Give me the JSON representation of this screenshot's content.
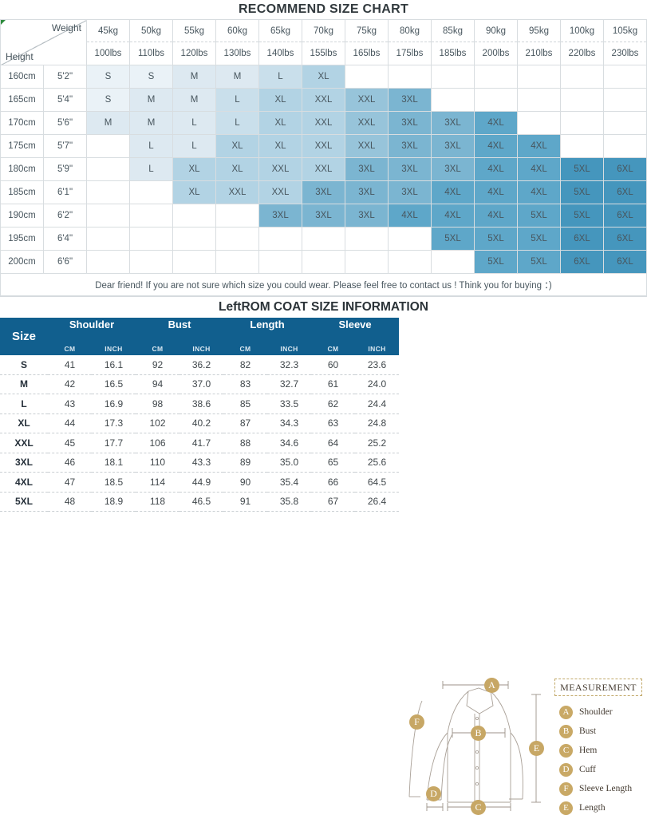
{
  "chart": {
    "title": "RECOMMEND SIZE CHART",
    "corner": {
      "weight_label": "Weight",
      "height_label": "Height"
    },
    "weights_kg": [
      "45kg",
      "50kg",
      "55kg",
      "60kg",
      "65kg",
      "70kg",
      "75kg",
      "80kg",
      "85kg",
      "90kg",
      "95kg",
      "100kg",
      "105kg"
    ],
    "weights_lbs": [
      "100lbs",
      "110lbs",
      "120lbs",
      "130lbs",
      "140lbs",
      "155lbs",
      "165lbs",
      "175lbs",
      "185lbs",
      "200lbs",
      "210lbs",
      "220lbs",
      "230lbs"
    ],
    "rows": [
      {
        "cm": "160cm",
        "inch": "5'2\"",
        "cells": [
          "S",
          "S",
          "M",
          "M",
          "L",
          "XL",
          "",
          "",
          "",
          "",
          "",
          "",
          ""
        ]
      },
      {
        "cm": "165cm",
        "inch": "5'4\"",
        "cells": [
          "S",
          "M",
          "M",
          "L",
          "XL",
          "XXL",
          "XXL",
          "3XL",
          "",
          "",
          "",
          "",
          ""
        ]
      },
      {
        "cm": "170cm",
        "inch": "5'6\"",
        "cells": [
          "M",
          "M",
          "L",
          "L",
          "XL",
          "XXL",
          "XXL",
          "3XL",
          "3XL",
          "4XL",
          "",
          "",
          ""
        ]
      },
      {
        "cm": "175cm",
        "inch": "5'7\"",
        "cells": [
          "",
          "L",
          "L",
          "XL",
          "XL",
          "XXL",
          "XXL",
          "3XL",
          "3XL",
          "4XL",
          "4XL",
          "",
          ""
        ]
      },
      {
        "cm": "180cm",
        "inch": "5'9\"",
        "cells": [
          "",
          "L",
          "XL",
          "XL",
          "XXL",
          "XXL",
          "3XL",
          "3XL",
          "3XL",
          "4XL",
          "4XL",
          "5XL",
          "6XL"
        ]
      },
      {
        "cm": "185cm",
        "inch": "6'1\"",
        "cells": [
          "",
          "",
          "XL",
          "XXL",
          "XXL",
          "3XL",
          "3XL",
          "3XL",
          "4XL",
          "4XL",
          "4XL",
          "5XL",
          "6XL"
        ]
      },
      {
        "cm": "190cm",
        "inch": "6'2\"",
        "cells": [
          "",
          "",
          "",
          "",
          "3XL",
          "3XL",
          "3XL",
          "4XL",
          "4XL",
          "4XL",
          "5XL",
          "5XL",
          "6XL"
        ]
      },
      {
        "cm": "195cm",
        "inch": "6'4\"",
        "cells": [
          "",
          "",
          "",
          "",
          "",
          "",
          "",
          "",
          "5XL",
          "5XL",
          "5XL",
          "6XL",
          "6XL"
        ]
      },
      {
        "cm": "200cm",
        "inch": "6'6\"",
        "cells": [
          "",
          "",
          "",
          "",
          "",
          "",
          "",
          "",
          "",
          "5XL",
          "5XL",
          "6XL",
          "6XL"
        ]
      }
    ],
    "footer_note": "Dear friend! If you are not sure which size you could wear. Please feel free to contact us ! Think you for buying ：)"
  },
  "coat": {
    "title": "LeftROM COAT SIZE INFORMATION",
    "size_header": "Size",
    "groups": [
      "Shoulder",
      "Bust",
      "Length",
      "Sleeve"
    ],
    "units": [
      "CM",
      "INCH",
      "CM",
      "INCH",
      "CM",
      "INCH",
      "CM",
      "INCH"
    ],
    "rows": [
      {
        "size": "S",
        "values": [
          "41",
          "16.1",
          "92",
          "36.2",
          "82",
          "32.3",
          "60",
          "23.6"
        ]
      },
      {
        "size": "M",
        "values": [
          "42",
          "16.5",
          "94",
          "37.0",
          "83",
          "32.7",
          "61",
          "24.0"
        ]
      },
      {
        "size": "L",
        "values": [
          "43",
          "16.9",
          "98",
          "38.6",
          "85",
          "33.5",
          "62",
          "24.4"
        ]
      },
      {
        "size": "XL",
        "values": [
          "44",
          "17.3",
          "102",
          "40.2",
          "87",
          "34.3",
          "63",
          "24.8"
        ]
      },
      {
        "size": "XXL",
        "values": [
          "45",
          "17.7",
          "106",
          "41.7",
          "88",
          "34.6",
          "64",
          "25.2"
        ]
      },
      {
        "size": "3XL",
        "values": [
          "46",
          "18.1",
          "110",
          "43.3",
          "89",
          "35.0",
          "65",
          "25.6"
        ]
      },
      {
        "size": "4XL",
        "values": [
          "47",
          "18.5",
          "114",
          "44.9",
          "90",
          "35.4",
          "66",
          "64.5"
        ]
      },
      {
        "size": "5XL",
        "values": [
          "48",
          "18.9",
          "118",
          "46.5",
          "91",
          "35.8",
          "67",
          "26.4"
        ]
      }
    ]
  },
  "diagram": {
    "legend_title": "MEASUREMENT",
    "legend": [
      {
        "letter": "A",
        "label": "Shoulder"
      },
      {
        "letter": "B",
        "label": "Bust"
      },
      {
        "letter": "C",
        "label": "Hem"
      },
      {
        "letter": "D",
        "label": "Cuff"
      },
      {
        "letter": "F",
        "label": "Sleeve Length"
      },
      {
        "letter": "E",
        "label": "Length"
      }
    ],
    "markers": [
      {
        "letter": "A"
      },
      {
        "letter": "B"
      },
      {
        "letter": "C"
      },
      {
        "letter": "D"
      },
      {
        "letter": "E"
      },
      {
        "letter": "F"
      }
    ]
  },
  "colors": {
    "header_blue": "#115f8e",
    "accent_gold": "#c9a966",
    "cell_scale": [
      "#ffffff",
      "#eaf2f7",
      "#dde9f1",
      "#c9dfeb",
      "#b2d3e4",
      "#97c4da",
      "#7bb5d1",
      "#5ea7c9",
      "#4596bd"
    ]
  }
}
